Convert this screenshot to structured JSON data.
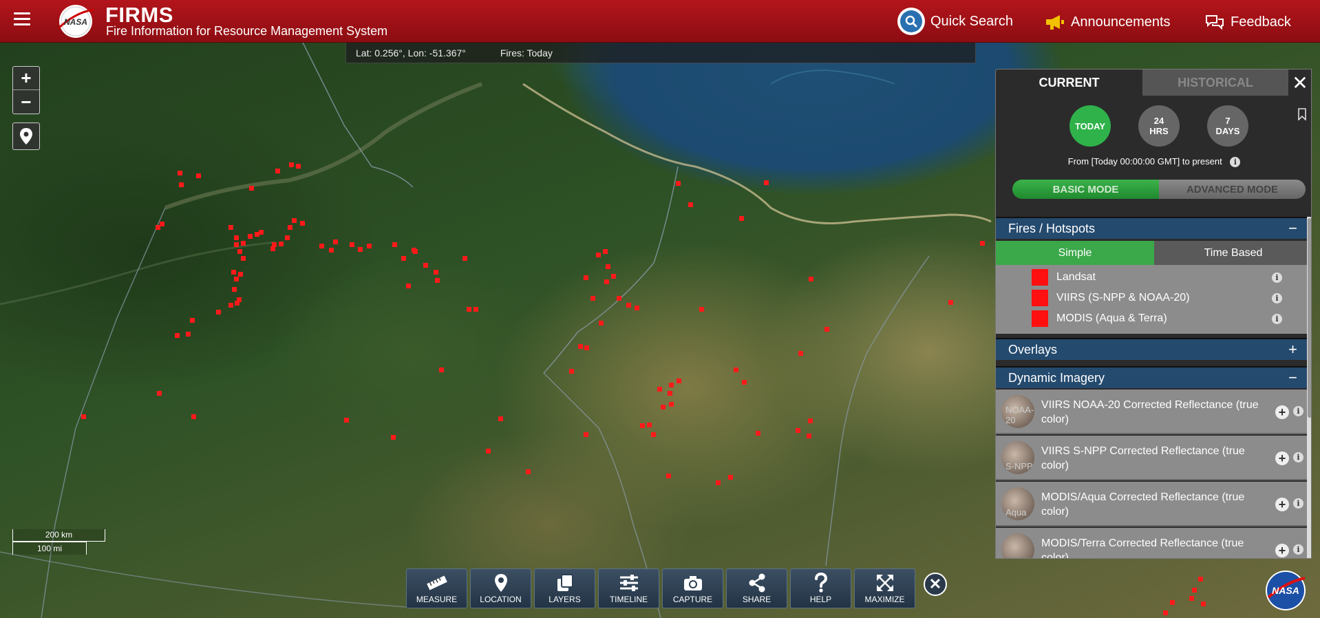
{
  "header": {
    "app_title": "FIRMS",
    "app_subtitle": "Fire Information for Resource Management System",
    "quick_search": "Quick Search",
    "announcements": "Announcements",
    "feedback": "Feedback",
    "logo_text": "NASA"
  },
  "coord_bar": {
    "coords": "Lat: 0.256°, Lon: -51.367°",
    "fires": "Fires: Today"
  },
  "map": {
    "zoom_in": "+",
    "zoom_out": "−",
    "scale_km": "200 km",
    "scale_mi": "100 mi",
    "fire_color": "#ff1a1a"
  },
  "toolbar": {
    "items": [
      {
        "label": "MEASURE",
        "icon": "ruler-icon"
      },
      {
        "label": "LOCATION",
        "icon": "map-pin-icon"
      },
      {
        "label": "LAYERS",
        "icon": "layers-icon"
      },
      {
        "label": "TIMELINE",
        "icon": "sliders-icon"
      },
      {
        "label": "CAPTURE",
        "icon": "camera-icon"
      },
      {
        "label": "SHARE",
        "icon": "share-icon"
      },
      {
        "label": "HELP",
        "icon": "question-icon"
      },
      {
        "label": "MAXIMIZE",
        "icon": "expand-icon"
      }
    ],
    "close": "✕"
  },
  "panel": {
    "tabs": {
      "current": "CURRENT",
      "historical": "HISTORICAL"
    },
    "close": "✕",
    "ranges": [
      {
        "line1": "TODAY",
        "line2": ""
      },
      {
        "line1": "24",
        "line2": "HRS"
      },
      {
        "line1": "7",
        "line2": "DAYS"
      }
    ],
    "from_text": "From [Today 00:00:00 GMT] to present",
    "mode": {
      "basic": "BASIC MODE",
      "advanced": "ADVANCED MODE"
    },
    "fires_section": {
      "title": "Fires / Hotspots",
      "toggle": "−",
      "sub_tabs": {
        "simple": "Simple",
        "time_based": "Time Based"
      },
      "layers": [
        "Landsat",
        "VIIRS (S-NPP & NOAA-20)",
        "MODIS (Aqua & Terra)"
      ]
    },
    "overlays_section": {
      "title": "Overlays",
      "toggle": "+"
    },
    "imagery_section": {
      "title": "Dynamic Imagery",
      "toggle": "−",
      "items": [
        {
          "title": "VIIRS NOAA-20 Corrected Reflectance (true color)",
          "thumb": "NOAA-20"
        },
        {
          "title": "VIIRS S-NPP Corrected Reflectance (true color)",
          "thumb": "S-NPP"
        },
        {
          "title": "MODIS/Aqua Corrected Reflectance (true color)",
          "thumb": "Aqua"
        },
        {
          "title": "MODIS/Terra Corrected Reflectance (true color)",
          "thumb": ""
        }
      ]
    },
    "accent_green": "#2fb24a",
    "section_blue": "#244a6e"
  }
}
